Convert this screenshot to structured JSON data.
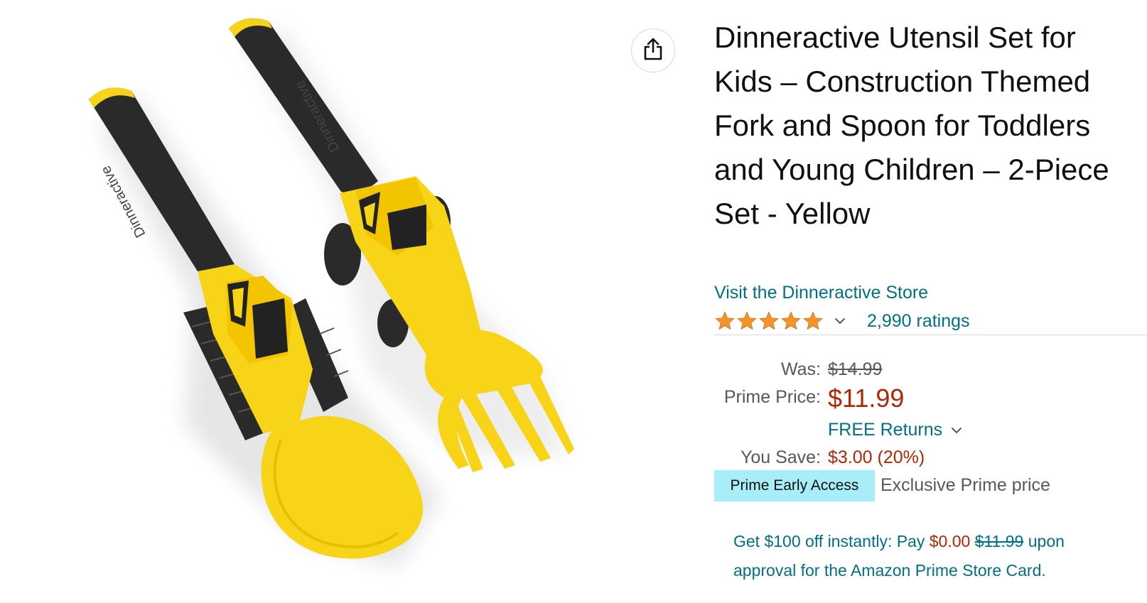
{
  "product": {
    "title": "Dinneractive Utensil Set for Kids – Construction Themed Fork and Spoon for Toddlers and Young Children – 2-Piece Set - Yellow",
    "store_link": "Visit the Dinneractive Store",
    "rating_stars": 5,
    "ratings_count": "2,990 ratings",
    "image_brand_text": "Dinneractive"
  },
  "pricing": {
    "was_label": "Was:",
    "was_price": "$14.99",
    "prime_price_label": "Prime Price:",
    "prime_price": "$11.99",
    "free_returns": "FREE Returns",
    "you_save_label": "You Save:",
    "you_save_value": "$3.00 (20%)",
    "badge": "Prime Early Access",
    "exclusive_text": "Exclusive Prime price"
  },
  "promo": {
    "prefix": "Get $100 off instantly: Pay",
    "pay_amount": "$0.00",
    "struck_amount": "$11.99",
    "suffix": "upon approval for the Amazon Prime Store Card."
  },
  "icons": {
    "share": "share-icon",
    "star": "star-icon",
    "chevron": "chevron-down-icon"
  },
  "colors": {
    "link": "#007185",
    "price": "#b12704",
    "star": "#f3932a",
    "badge_bg": "#a8eef8",
    "utensil_yellow": "#f7d417",
    "handle_black": "#2a2a2a"
  }
}
